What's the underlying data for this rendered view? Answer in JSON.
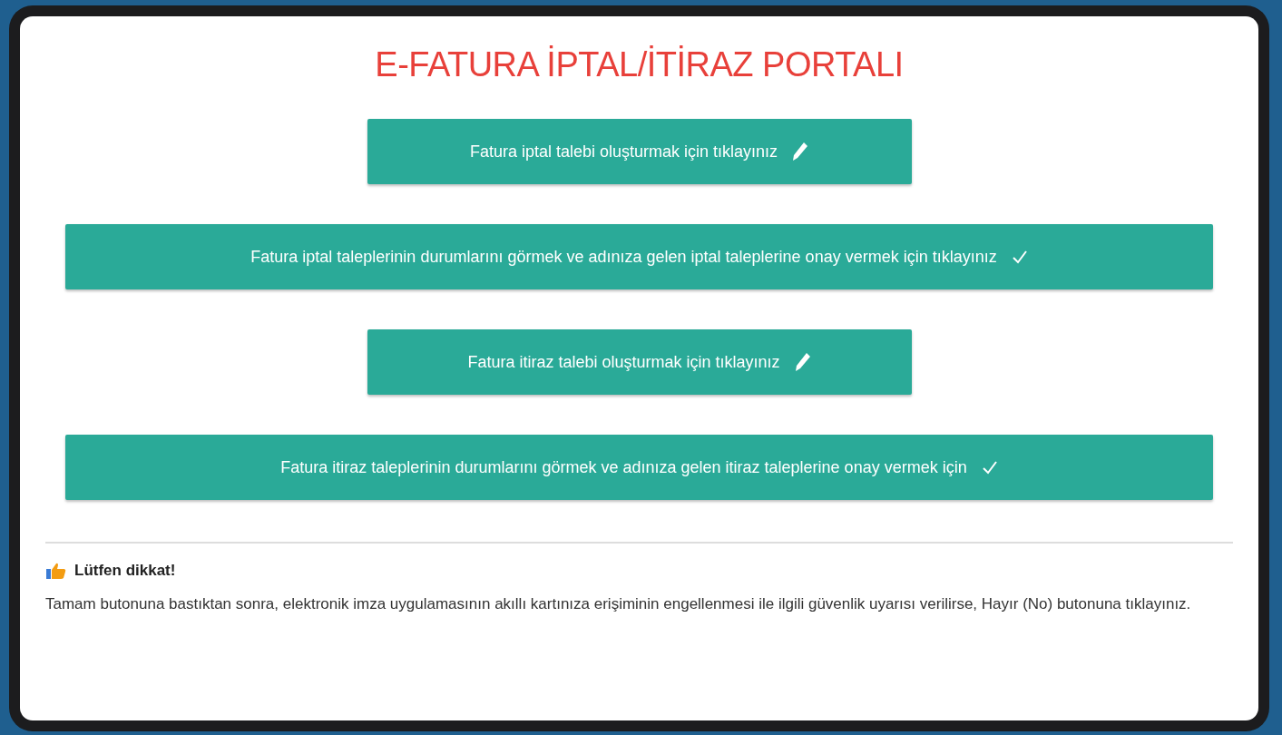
{
  "title": "E-FATURA İPTAL/İTİRAZ PORTALI",
  "buttons": [
    {
      "kind": "create",
      "label": "Fatura iptal talebi oluşturmak için tıklayınız"
    },
    {
      "kind": "view",
      "label": "Fatura iptal taleplerinin durumlarını görmek ve adınıza gelen iptal taleplerine onay vermek için tıklayınız"
    },
    {
      "kind": "create",
      "label": "Fatura itiraz talebi oluşturmak için tıklayınız"
    },
    {
      "kind": "view",
      "label": "Fatura itiraz taleplerinin durumlarını görmek ve adınıza gelen itiraz taleplerine onay vermek için"
    }
  ],
  "notice": {
    "heading": "Lütfen dikkat!",
    "text": "Tamam butonuna bastıktan sonra, elektronik imza uygulamasının akıllı kartınıza erişiminin engellenmesi ile ilgili güvenlik uyarısı verilirse, Hayır (No) butonuna tıklayınız."
  }
}
